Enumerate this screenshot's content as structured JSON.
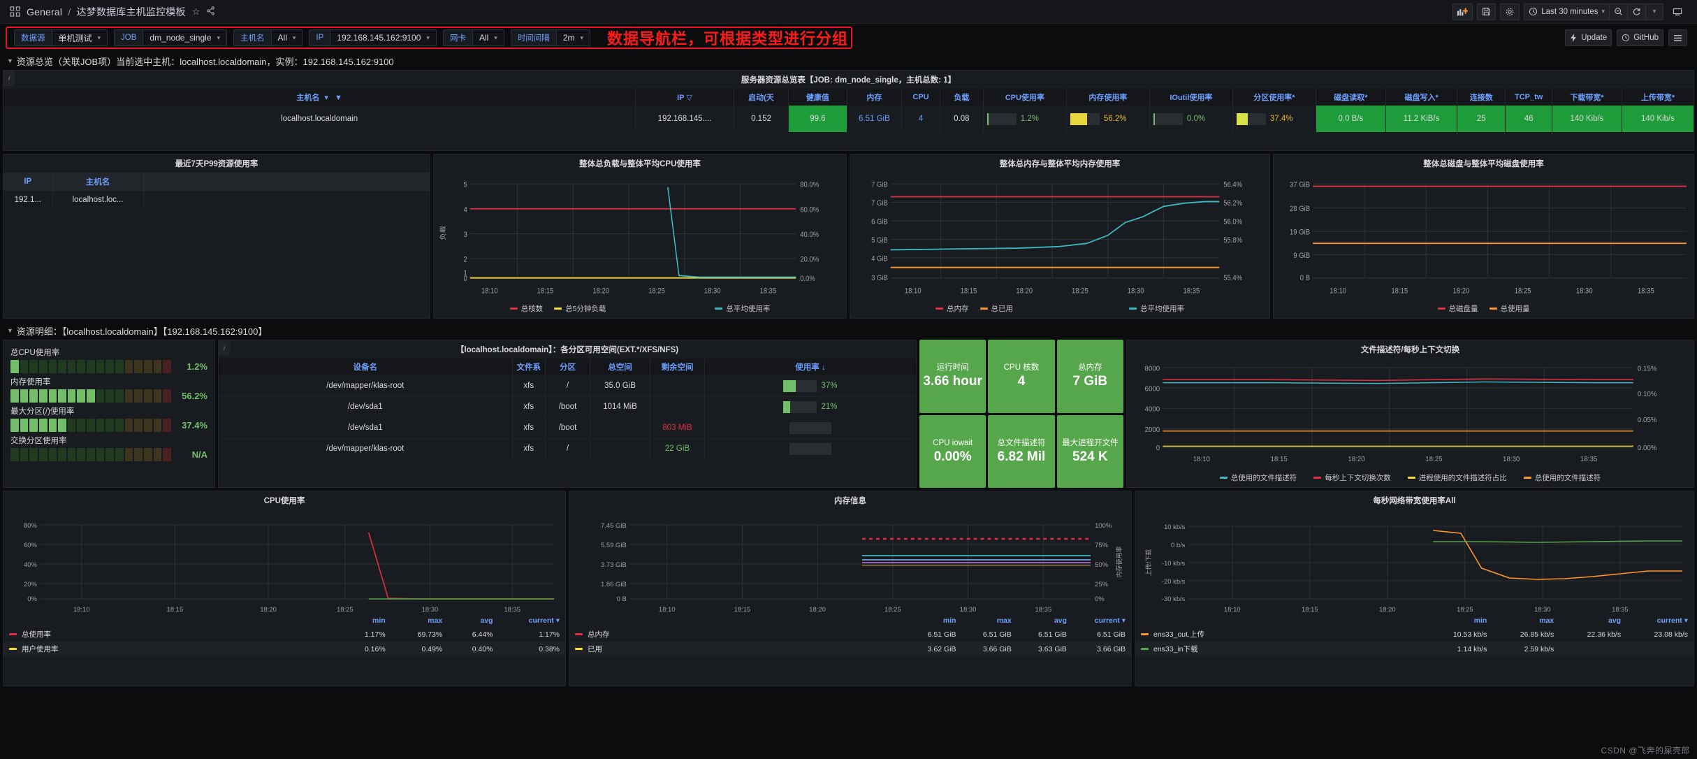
{
  "header": {
    "breadcrumb_root": "General",
    "breadcrumb_sep": "/",
    "dashboard_title": "达梦数据库主机监控模板",
    "star_icon": "star-icon",
    "share_icon": "share-icon",
    "time_range": "Last 30 minutes",
    "buttons": {
      "add_panel": "add-panel-icon",
      "save": "save-icon",
      "settings": "gear-icon",
      "zoom_out": "zoom-out-icon",
      "refresh": "refresh-icon",
      "tv": "tv-mode-icon"
    }
  },
  "variables": [
    {
      "label": "数据源",
      "value": "单机测试",
      "name": "datasource"
    },
    {
      "label": "JOB",
      "value": "dm_node_single",
      "name": "job"
    },
    {
      "label": "主机名",
      "value": "All",
      "name": "hostname"
    },
    {
      "label": "IP",
      "value": "192.168.145.162:9100",
      "name": "ip"
    },
    {
      "label": "网卡",
      "value": "All",
      "name": "nic"
    },
    {
      "label": "时间间隔",
      "value": "2m",
      "name": "interval"
    }
  ],
  "annotation": "数据导航栏，可根据类型进行分组",
  "toolbar_right": {
    "update": "Update",
    "github": "GitHub",
    "menu_icon": "hamburger-icon"
  },
  "rows": {
    "overview": "资源总览（关联JOB项）当前选中主机：localhost.localdomain，实例：192.168.145.162:9100",
    "detail": "资源明细：【localhost.localdomain】【192.168.145.162:9100】"
  },
  "overview_table": {
    "title": "服务器资源总览表【JOB: dm_node_single，主机总数: 1】",
    "columns": [
      "主机名",
      "IP",
      "启动(天",
      "健康值",
      "内存",
      "CPU",
      "负载",
      "CPU使用率",
      "内存使用率",
      "IOutil使用率",
      "分区使用率*",
      "磁盘读取*",
      "磁盘写入*",
      "连接数",
      "TCP_tw",
      "下载带宽*",
      "上传带宽*"
    ],
    "row": {
      "hostname": "localhost.localdomain",
      "ip": "192.168.145....",
      "uptime_days": "0.152",
      "health": "99.6",
      "memory": "6.51 GiB",
      "cpu": "4",
      "load": "0.08",
      "cpu_usage": "1.2%",
      "mem_usage": "56.2%",
      "ioutil": "0.0%",
      "partition_usage": "37.4%",
      "disk_read": "0.0 B/s",
      "disk_write": "11.2 KiB/s",
      "connections": "25",
      "tcp_tw": "46",
      "download": "140 Kib/s",
      "upload": "140 Kib/s"
    }
  },
  "p99_panel": {
    "title": "最近7天P99资源使用率",
    "columns": [
      "IP",
      "主机名"
    ],
    "rows": [
      [
        "192.1...",
        "localhost.loc..."
      ]
    ]
  },
  "chart_data": [
    {
      "id": "load_cpu",
      "type": "line",
      "title": "整体总负载与整体平均CPU使用率",
      "xlabel": "",
      "ylabel_left": "负载",
      "ylabel_right": "",
      "x_ticks": [
        "18:10",
        "18:15",
        "18:20",
        "18:25",
        "18:30",
        "18:35"
      ],
      "y_left_ticks": [
        "0",
        "1",
        "2",
        "3",
        "4",
        "5"
      ],
      "y_right_ticks": [
        "0.0%",
        "20.0%",
        "40.0%",
        "60.0%",
        "80.0%"
      ],
      "ylim_left": [
        0,
        5
      ],
      "ylim_right": [
        0,
        80
      ],
      "grid": true,
      "legend_position": "bottom",
      "series": [
        {
          "name": "总核数",
          "color": "#e02f44",
          "axis": "left",
          "values": [
            4,
            4,
            4,
            4,
            4,
            4,
            4
          ]
        },
        {
          "name": "总5分钟负载",
          "color": "#fade2a",
          "axis": "left",
          "values": [
            0,
            0,
            0,
            0,
            0.08,
            0.08,
            0.08
          ]
        },
        {
          "name": "总平均使用率",
          "color": "#3eb8bf",
          "axis": "right",
          "values": [
            0,
            0,
            0,
            72,
            1.5,
            1.2,
            1.2
          ]
        }
      ]
    },
    {
      "id": "mem_total_usage",
      "type": "line",
      "title": "整体总内存与整体平均内存使用率",
      "x_ticks": [
        "18:10",
        "18:15",
        "18:20",
        "18:25",
        "18:30",
        "18:35"
      ],
      "y_left_ticks": [
        "3 GiB",
        "4 GiB",
        "5 GiB",
        "6 GiB",
        "7 GiB",
        "7 GiB"
      ],
      "y_right_ticks": [
        "55.4%",
        "55.8%",
        "56.0%",
        "56.2%",
        "56.4%"
      ],
      "ylim_right": [
        55.4,
        56.4
      ],
      "grid": true,
      "legend_position": "bottom",
      "series": [
        {
          "name": "总内存",
          "color": "#e02f44",
          "axis": "left",
          "values": [
            6.51,
            6.51,
            6.51,
            6.51,
            6.51,
            6.51
          ]
        },
        {
          "name": "总已用",
          "color": "#ff9830",
          "axis": "left",
          "values": [
            3.62,
            3.62,
            3.63,
            3.64,
            3.66,
            3.66
          ]
        },
        {
          "name": "总平均使用率",
          "color": "#3eb8bf",
          "axis": "right",
          "values": [
            55.7,
            55.72,
            55.75,
            55.8,
            56.1,
            56.2
          ]
        }
      ]
    },
    {
      "id": "disk_total_usage",
      "type": "line",
      "title": "整体总磁盘与整体平均磁盘使用率",
      "x_ticks": [
        "18:10",
        "18:15",
        "18:20",
        "18:25",
        "18:30",
        "18:35"
      ],
      "y_left_ticks": [
        "0 B",
        "9 GiB",
        "19 GiB",
        "28 GiB",
        "37 GiB"
      ],
      "ylim_left": [
        0,
        37
      ],
      "grid": true,
      "legend_position": "bottom",
      "series": [
        {
          "name": "总磁盘量",
          "color": "#e02f44",
          "axis": "left",
          "values": [
            36,
            36,
            36,
            36,
            36,
            36
          ]
        },
        {
          "name": "总使用量",
          "color": "#ff9830",
          "axis": "left",
          "values": [
            13.5,
            13.5,
            13.5,
            13.5,
            13.5,
            13.5
          ]
        }
      ]
    },
    {
      "id": "fd_ctxswitch",
      "type": "line",
      "title": "文件描述符/每秒上下文切换",
      "x_ticks": [
        "18:10",
        "18:15",
        "18:20",
        "18:25",
        "18:30",
        "18:35"
      ],
      "y_left_ticks": [
        "0",
        "2000",
        "4000",
        "6000",
        "8000"
      ],
      "y_right_ticks": [
        "0.00%",
        "0.05%",
        "0.10%",
        "0.15%"
      ],
      "ylim_left": [
        0,
        8000
      ],
      "ylim_right": [
        0,
        0.15
      ],
      "grid": true,
      "legend_position": "bottom",
      "series": [
        {
          "name": "总使用的文件描述符",
          "color": "#3eb8bf",
          "axis": "left",
          "values": [
            7000,
            7000,
            7000,
            7000,
            7000,
            7000
          ]
        },
        {
          "name": "每秒上下文切换次数",
          "color": "#e02f44",
          "axis": "left",
          "values": [
            6700,
            6700,
            6700,
            6700,
            6700,
            6700
          ]
        },
        {
          "name": "进程使用的文件描述符占比",
          "color": "#fade2a",
          "axis": "right",
          "values": [
            0.01,
            0.01,
            0.01,
            0.01,
            0.01,
            0.01
          ]
        },
        {
          "name": "总使用的文件描述符",
          "color": "#ff9830",
          "axis": "left",
          "values": [
            2000,
            2000,
            2000,
            2000,
            2000,
            2000
          ]
        }
      ]
    },
    {
      "id": "cpu_usage",
      "type": "line",
      "title": "CPU使用率",
      "x_ticks": [
        "18:10",
        "18:15",
        "18:20",
        "18:25",
        "18:30",
        "18:35"
      ],
      "y_ticks": [
        "0%",
        "20%",
        "40%",
        "60%",
        "80%"
      ],
      "ylim": [
        0,
        80
      ],
      "grid": true,
      "legend_position": "table",
      "legend_headers": [
        "min",
        "max",
        "avg",
        "current"
      ],
      "series": [
        {
          "name": "总使用率",
          "color": "#e02f44",
          "min": "1.17%",
          "max": "69.73%",
          "avg": "6.44%",
          "current": "1.17%"
        },
        {
          "name": "用户使用率",
          "color": "#fade2a",
          "min": "0.16%",
          "max": "0.49%",
          "avg": "0.40%",
          "current": "0.38%"
        }
      ]
    },
    {
      "id": "mem_info",
      "type": "line",
      "title": "内存信息",
      "x_ticks": [
        "18:10",
        "18:15",
        "18:20",
        "18:25",
        "18:30",
        "18:35"
      ],
      "y_left_ticks": [
        "0 B",
        "1.86 GiB",
        "3.73 GiB",
        "5.59 GiB",
        "7.45 GiB"
      ],
      "y_right_ticks": [
        "0%",
        "25%",
        "50%",
        "75%",
        "100%"
      ],
      "ylabel_right": "内存使用率",
      "grid": true,
      "legend_position": "table",
      "legend_headers": [
        "min",
        "max",
        "avg",
        "current"
      ],
      "series": [
        {
          "name": "总内存",
          "color": "#e02f44",
          "min": "6.51 GiB",
          "max": "6.51 GiB",
          "avg": "6.51 GiB",
          "current": "6.51 GiB"
        },
        {
          "name": "已用",
          "color": "#fade2a",
          "min": "3.62 GiB",
          "max": "3.66 GiB",
          "avg": "3.63 GiB",
          "current": "3.66 GiB"
        }
      ]
    },
    {
      "id": "net_bandwidth",
      "type": "line",
      "title": "每秒网络带宽使用率All",
      "x_ticks": [
        "18:10",
        "18:15",
        "18:20",
        "18:25",
        "18:30",
        "18:35"
      ],
      "y_ticks": [
        "-30 kb/s",
        "-20 kb/s",
        "-10 kb/s",
        "0 b/s",
        "10 kb/s"
      ],
      "ylabel": "上传/下载",
      "ylim": [
        -30,
        10
      ],
      "grid": true,
      "legend_position": "table",
      "legend_headers": [
        "min",
        "max",
        "avg",
        "current"
      ],
      "series": [
        {
          "name": "ens33_out.上传",
          "color": "#ff9830",
          "min": "10.53 kb/s",
          "max": "26.85 kb/s",
          "avg": "22.36 kb/s",
          "current": "23.08 kb/s"
        },
        {
          "name": "ens33_in下载",
          "color": "#56a64b",
          "min": "1.14 kb/s",
          "max": "2.59 kb/s",
          "avg": "",
          "current": ""
        }
      ]
    }
  ],
  "bargauge": {
    "items": [
      {
        "label": "总CPU使用率",
        "value": "1.2%",
        "pct": 1.2,
        "color": "#73bf69"
      },
      {
        "label": "内存使用率",
        "value": "56.2%",
        "pct": 56.2,
        "color": "#73bf69"
      },
      {
        "label": "最大分区(/)使用率",
        "value": "37.4%",
        "pct": 37.4,
        "color": "#73bf69"
      },
      {
        "label": "交换分区使用率",
        "value": "N/A",
        "pct": 0,
        "color": "#73bf69"
      }
    ]
  },
  "disk_panel": {
    "title": "【localhost.localdomain】：各分区可用空间(EXT.*/XFS/NFS)",
    "columns": [
      "设备名",
      "文件系",
      "分区",
      "总空间",
      "剩余空间",
      "使用率 ↓"
    ],
    "rows": [
      {
        "device": "/dev/mapper/klas-root",
        "fs": "xfs",
        "mount": "/",
        "total": "35.0 GiB",
        "free": "",
        "usage": "37%",
        "pct": 37,
        "free_color": "#d8d9da",
        "has_bar": true
      },
      {
        "device": "/dev/sda1",
        "fs": "xfs",
        "mount": "/boot",
        "total": "1014 MiB",
        "free": "",
        "usage": "21%",
        "pct": 21,
        "free_color": "#d8d9da",
        "has_bar": true
      },
      {
        "device": "/dev/sda1",
        "fs": "xfs",
        "mount": "/boot",
        "total": "",
        "free": "803 MiB",
        "usage": "",
        "pct": 0,
        "free_color": "#e02f44",
        "has_bar": false
      },
      {
        "device": "/dev/mapper/klas-root",
        "fs": "xfs",
        "mount": "/",
        "total": "",
        "free": "22 GiB",
        "usage": "",
        "pct": 0,
        "free_color": "#73bf69",
        "has_bar": false
      }
    ]
  },
  "stats": [
    {
      "name": "运行时间",
      "value": "3.66 hour"
    },
    {
      "name": "CPU 核数",
      "value": "4"
    },
    {
      "name": "总内存",
      "value": "7 GiB"
    },
    {
      "name": "CPU iowait",
      "value": "0.00%"
    },
    {
      "name": "总文件描述符",
      "value": "6.82 Mil"
    },
    {
      "name": "最大进程开文件",
      "value": "524 K"
    }
  ],
  "watermark": "CSDN @飞奔的屎壳郎"
}
